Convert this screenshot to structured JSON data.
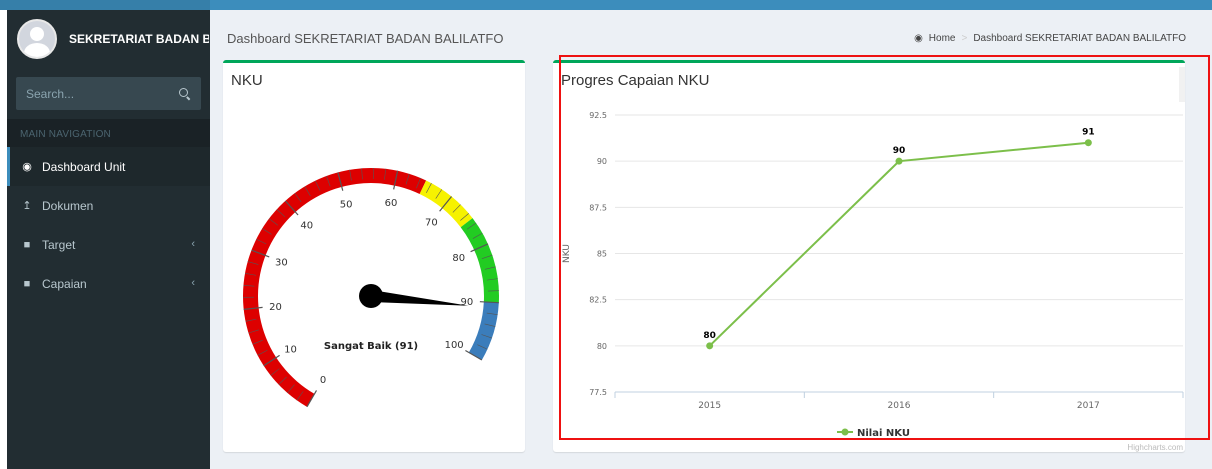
{
  "sidebar": {
    "user_name": "SEKRETARIAT BADAN BALILATFO",
    "search_placeholder": "Search...",
    "nav_header": "MAIN NAVIGATION",
    "items": [
      {
        "label": "Dashboard Unit",
        "icon": "dashboard-icon",
        "active": true
      },
      {
        "label": "Dokumen",
        "icon": "upload-icon"
      },
      {
        "label": "Target",
        "icon": "folder-icon"
      },
      {
        "label": "Capaian",
        "icon": "folder-icon"
      }
    ]
  },
  "header": {
    "title": "Dashboard SEKRETARIAT BADAN BALILATFO",
    "breadcrumb_home": "Home",
    "breadcrumb_current": "Dashboard SEKRETARIAT BADAN BALILATFO"
  },
  "gauge": {
    "title": "NKU",
    "value": 91,
    "min": 0,
    "max": 100,
    "ticks": [
      "0",
      "10",
      "20",
      "30",
      "40",
      "50",
      "60",
      "70",
      "80",
      "90",
      "100"
    ],
    "label": "Sangat Baik (91)",
    "bands": [
      {
        "from": 0,
        "to": 65,
        "color": "#dd0000"
      },
      {
        "from": 65,
        "to": 75,
        "color": "#f6f200"
      },
      {
        "from": 75,
        "to": 90,
        "color": "#22cc22"
      },
      {
        "from": 90,
        "to": 100,
        "color": "#3b7dbb"
      }
    ]
  },
  "colors": {
    "accent": "#3c8dbc",
    "box_border": "#00a65a",
    "line": "#7cbf4a"
  },
  "chart_data": {
    "type": "line",
    "title": "Progres Capaian NKU",
    "categories": [
      "2015",
      "2016",
      "2017"
    ],
    "series": [
      {
        "name": "Nilai NKU",
        "values": [
          80,
          90,
          91
        ]
      }
    ],
    "ylabel": "NKU",
    "ylim": [
      77.5,
      92.5
    ],
    "yticks": [
      "92.5",
      "90",
      "87.5",
      "85",
      "82.5",
      "80",
      "77.5"
    ],
    "credits": "Highcharts.com"
  }
}
